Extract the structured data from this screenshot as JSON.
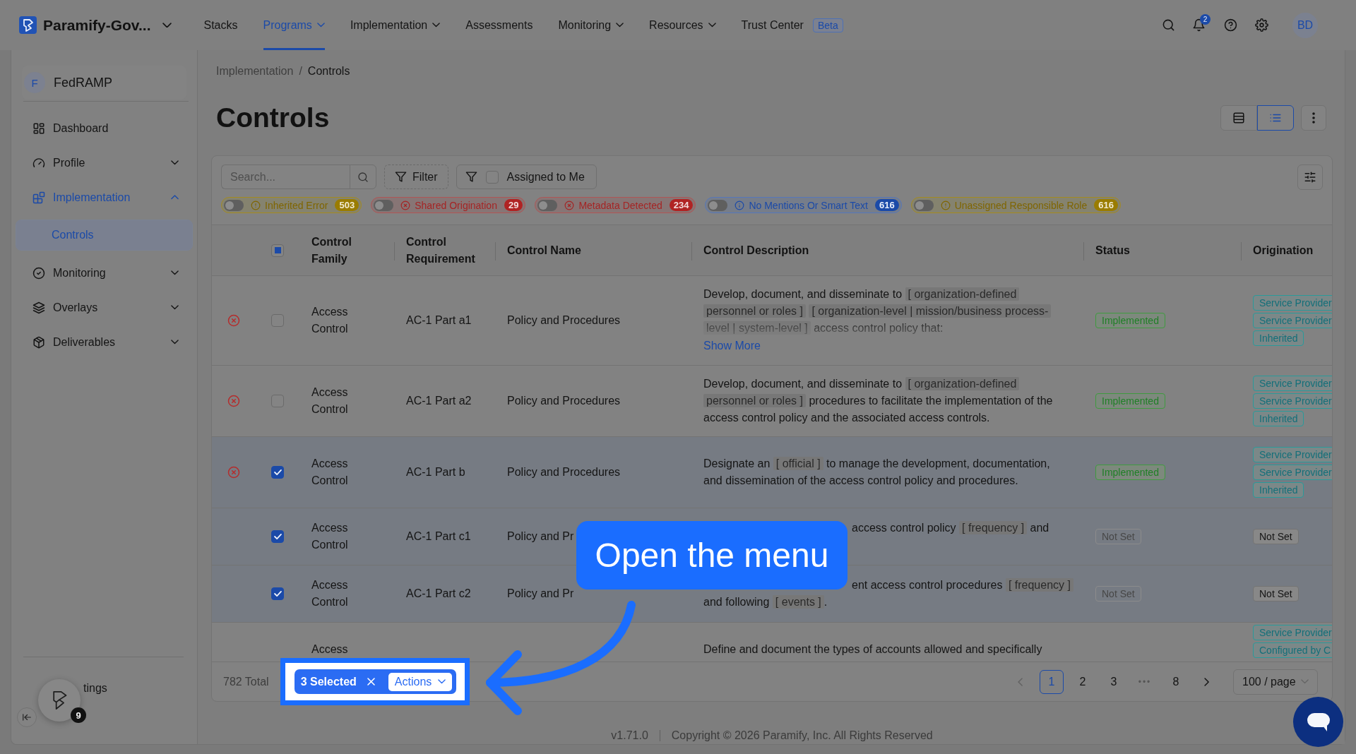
{
  "app_bar": {
    "product": "Paramify-Gov...",
    "nav": [
      {
        "label": "Stacks",
        "kind": "link",
        "selected": false
      },
      {
        "label": "Programs",
        "kind": "menu",
        "selected": true
      },
      {
        "label": "Implementation",
        "kind": "menu",
        "selected": false
      },
      {
        "label": "Assessments",
        "kind": "link",
        "selected": false
      },
      {
        "label": "Monitoring",
        "kind": "menu",
        "selected": false
      },
      {
        "label": "Resources",
        "kind": "menu",
        "selected": false
      },
      {
        "label": "Trust Center",
        "kind": "link",
        "selected": false,
        "badge": "Beta"
      }
    ],
    "notifications": "2",
    "avatar": "BD"
  },
  "sidebar": {
    "org": {
      "initial": "F",
      "name": "FedRAMP"
    },
    "items": [
      {
        "label": "Dashboard",
        "kind": "link"
      },
      {
        "label": "Profile",
        "kind": "group",
        "expanded": false
      },
      {
        "label": "Implementation",
        "kind": "group",
        "expanded": true,
        "children": [
          {
            "label": "Controls",
            "selected": true
          }
        ]
      },
      {
        "label": "Monitoring",
        "kind": "group",
        "expanded": false
      },
      {
        "label": "Overlays",
        "kind": "group",
        "expanded": false
      },
      {
        "label": "Deliverables",
        "kind": "group",
        "expanded": false
      }
    ],
    "settings": "tings",
    "launcher_count": "9"
  },
  "breadcrumb": {
    "items": [
      "Implementation",
      "Controls"
    ],
    "separator": "/"
  },
  "title": "Controls",
  "view_modes": [
    {
      "selected": false
    },
    {
      "selected": true
    }
  ],
  "toolbar": {
    "search": {
      "placeholder": "Search..."
    },
    "filter": "Filter",
    "assigned": {
      "label": "Assigned to Me",
      "checked": false
    }
  },
  "chips": [
    {
      "label": "Inherited Error",
      "count": "503",
      "kind": "warning",
      "on": false
    },
    {
      "label": "Shared Origination",
      "count": "29",
      "kind": "error",
      "on": false
    },
    {
      "label": "Metadata Detected",
      "count": "234",
      "kind": "error",
      "on": false
    },
    {
      "label": "No Mentions Or Smart Text",
      "count": "616",
      "kind": "info",
      "on": false
    },
    {
      "label": "Unassigned Responsible Role",
      "count": "616",
      "kind": "warning",
      "on": false
    }
  ],
  "table": {
    "select_all": {
      "partial": true
    },
    "columns": [
      "Control Family",
      "Control Requirement",
      "Control Name",
      "Control Description",
      "Status",
      "Origination"
    ],
    "rows": [
      {
        "kind": "full",
        "error": true,
        "checked": false,
        "family": "Access Control",
        "requirement": "AC-1 Part a1",
        "name": "Policy and Procedures",
        "description": {
          "lines": [
            [
              {
                "kind": "text",
                "text": "Develop, document, and disseminate to "
              },
              {
                "kind": "param",
                "text": "[ organization-defined"
              }
            ],
            [
              {
                "kind": "param",
                "text": "personnel or roles ]"
              },
              {
                "kind": "param",
                "text": "[ organization-level | mission/business process-"
              }
            ],
            [
              {
                "kind": "param",
                "text": "level | system-level ]"
              },
              {
                "kind": "text",
                "text": " access control policy that:"
              }
            ]
          ],
          "truncated": true,
          "show_more": "Show More"
        },
        "status": {
          "label": "Implemented",
          "kind": "implemented"
        },
        "origination": [
          {
            "label": "Service Provider",
            "kind": "tag"
          },
          {
            "label": "Service Provider",
            "kind": "tag"
          },
          {
            "label": "Inherited",
            "kind": "tag"
          }
        ]
      },
      {
        "kind": "full",
        "error": true,
        "checked": false,
        "family": "Access Control",
        "requirement": "AC-1 Part a2",
        "name": "Policy and Procedures",
        "description": {
          "lines": [
            [
              {
                "kind": "text",
                "text": "Develop, document, and disseminate to "
              },
              {
                "kind": "param",
                "text": "[ organization-defined"
              }
            ],
            [
              {
                "kind": "param",
                "text": "personnel or roles ]"
              },
              {
                "kind": "text",
                "text": " procedures to facilitate the implementation of the"
              }
            ],
            [
              {
                "kind": "text",
                "text": "access control policy and the associated access controls."
              }
            ]
          ],
          "truncated": false
        },
        "status": {
          "label": "Implemented",
          "kind": "implemented"
        },
        "origination": [
          {
            "label": "Service Provider",
            "kind": "tag"
          },
          {
            "label": "Service Provider",
            "kind": "tag"
          },
          {
            "label": "Inherited",
            "kind": "tag"
          }
        ]
      },
      {
        "kind": "full",
        "error": true,
        "checked": true,
        "family": "Access Control",
        "requirement": "AC-1 Part b",
        "name": "Policy and Procedures",
        "description": {
          "lines": [
            [
              {
                "kind": "text",
                "text": "Designate an "
              },
              {
                "kind": "param",
                "text": "[ official ]"
              },
              {
                "kind": "text",
                "text": " to manage the development, documentation,"
              }
            ],
            [
              {
                "kind": "text",
                "text": "and dissemination of the access control policy and procedures."
              }
            ]
          ],
          "truncated": false
        },
        "status": {
          "label": "Implemented",
          "kind": "implemented"
        },
        "origination": [
          {
            "label": "Service Provider",
            "kind": "tag"
          },
          {
            "label": "Service Provider",
            "kind": "tag"
          },
          {
            "label": "Inherited",
            "kind": "tag"
          }
        ]
      },
      {
        "kind": "under_callout",
        "error": false,
        "checked": true,
        "family": "Access Control",
        "requirement": "AC-1 Part c1",
        "name": "Policy and Pr",
        "description": {
          "lines": [
            [
              {
                "kind": "text",
                "text": "access control policy "
              },
              {
                "kind": "param",
                "text": "[ frequency ]"
              },
              {
                "kind": "text",
                "text": " and"
              }
            ]
          ],
          "truncated": false
        },
        "status": {
          "label": "Not Set",
          "kind": "unset"
        },
        "origination": [
          {
            "label": "Not Set",
            "kind": "plain"
          }
        ]
      },
      {
        "kind": "under_callout",
        "error": false,
        "checked": true,
        "family": "Access Control",
        "requirement": "AC-1 Part c2",
        "name": "Policy and Pr",
        "description": {
          "lines": [
            [
              {
                "kind": "text",
                "text": "ent access control procedures "
              },
              {
                "kind": "param",
                "text": "[ frequency ]"
              }
            ],
            [
              {
                "kind": "text",
                "text": "and following "
              },
              {
                "kind": "param",
                "text": "[ events ]"
              },
              {
                "kind": "text",
                "text": "."
              }
            ]
          ],
          "truncated": false
        },
        "status": {
          "label": "Not Set",
          "kind": "unset"
        },
        "origination": [
          {
            "label": "Not Set",
            "kind": "plain"
          }
        ]
      },
      {
        "kind": "cut_off",
        "family": "Access",
        "description": {
          "lines": [
            [
              {
                "kind": "text",
                "text": "Define and document the types of accounts allowed and specifically"
              }
            ]
          ],
          "truncated": false
        },
        "origination": [
          {
            "label": "Service Provider",
            "kind": "tag"
          },
          {
            "label": "Configured by C",
            "kind": "tag"
          }
        ]
      }
    ]
  },
  "footer": {
    "total": "782 Total",
    "selection": {
      "count": "3 Selected",
      "action": "Actions"
    },
    "pagination": {
      "previous": {
        "disabled": true
      },
      "next": {
        "disabled": false
      },
      "pages": [
        {
          "label": "1",
          "kind": "page",
          "selected": true
        },
        {
          "label": "2",
          "kind": "page",
          "selected": false
        },
        {
          "label": "3",
          "kind": "page",
          "selected": false
        },
        {
          "label": "•••",
          "kind": "ellipsis"
        },
        {
          "label": "8",
          "kind": "page",
          "selected": false
        }
      ],
      "page_size": "100 / page"
    }
  },
  "callout": "Open the menu",
  "page_footer": {
    "version": "v1.71.0",
    "copyright": "Copyright © 2026 Paramify, Inc. All Rights Reserved"
  }
}
